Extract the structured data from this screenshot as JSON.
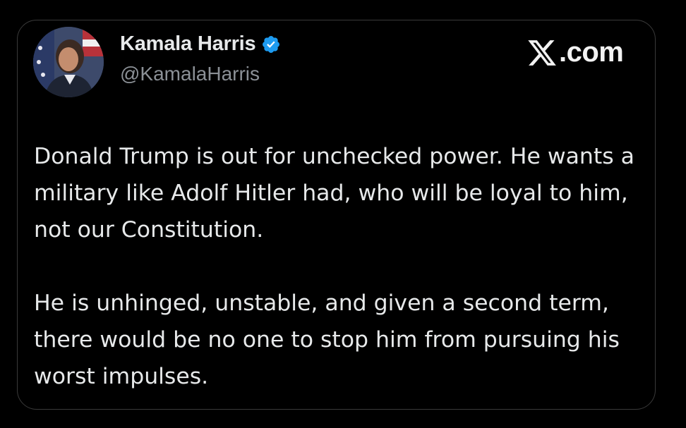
{
  "author": {
    "display_name": "Kamala Harris",
    "handle": "@KamalaHarris",
    "verified_icon": "verified-badge-icon"
  },
  "brand": {
    "logo_icon": "x-logo-icon",
    "text": ".com"
  },
  "post": {
    "paragraphs": [
      "Donald Trump is out for unchecked power. He wants a military like Adolf Hitler had, who will be loyal to him, not our Constitution.",
      "He is unhinged, unstable, and given a second term, there would be no one to stop him from pursuing his worst impulses."
    ]
  },
  "colors": {
    "background": "#000000",
    "text": "#e7e9ea",
    "handle": "#8b9096",
    "verified": "#1d9bf0",
    "border": "#3a3a3a"
  }
}
